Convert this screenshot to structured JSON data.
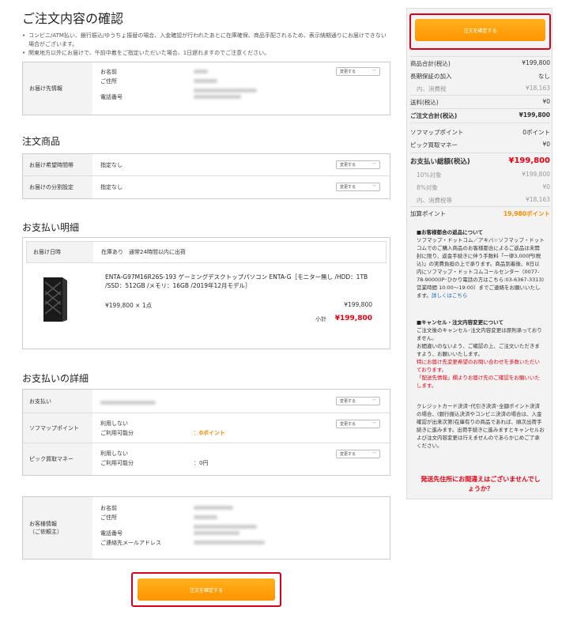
{
  "page": {
    "title": "ご注文内容の確認",
    "notes": [
      "コンビニ/ATM払い、銀行振込/ゆうちょ振替の場合、入金確認が行われたあとに在庫確保、商品手配されるため、表示納期通りにお届けできない場合がございます。",
      "関東地方以外にお届けで、午前中着をご指定いただいた場合、1日遅れますのでご注意ください。"
    ]
  },
  "delivery": {
    "label": "お届け先情報",
    "name_label": "お名前",
    "address_label": "ご住所",
    "phone_label": "電話番号",
    "change_label": "変更する"
  },
  "items_section": {
    "title": "注文商品",
    "rows": [
      {
        "label": "お届け希望時間帯",
        "value": "指定なし",
        "change": "変更する"
      },
      {
        "label": "お届けの分割設定",
        "value": "指定なし",
        "change": "変更する"
      }
    ]
  },
  "payment_detail": {
    "title": "お支払い明細",
    "date_label": "お届け日時",
    "date_value": "在庫あり　通常24時間以内に出荷",
    "product_name": "ENTA-G97M16R26S-193 ゲーミングデスクトップパソコン ENTA-G［モニター無し /HDD：1TB /SSD：512GB /メモリ：16GB /2019年12月モデル］",
    "unit_line": "¥199,800 × 1点",
    "line_total": "¥199,800",
    "subtotal_label": "小計",
    "subtotal_value": "¥199,800"
  },
  "payment_info": {
    "title": "お支払いの詳細",
    "method_label": "お支払い",
    "points_label": "ソフマップポイント",
    "points_use": "利用しない",
    "points_avail_label": "ご利用可能分",
    "points_avail_value": "0ポイント",
    "pick_label": "ピック買取マネー",
    "pick_use": "利用しない",
    "pick_avail_label": "ご利用可能分",
    "pick_avail_value": "0円",
    "change_label": "変更する"
  },
  "customer": {
    "label": "お客様情報\n（ご依頼主）",
    "name_label": "お名前",
    "address_label": "ご住所",
    "phone_label": "電話番号",
    "email_label": "ご連絡先メールアドレス"
  },
  "confirm_button": "注文を確定する",
  "summary": {
    "rows": [
      {
        "label": "商品合計(税込)",
        "value": "¥199,800"
      },
      {
        "label": "長期保証の加入",
        "value": "なし"
      },
      {
        "label": "内、消費税",
        "value": "¥18,163"
      },
      {
        "label": "送料(税込)",
        "value": "¥0"
      },
      {
        "label": "ご注文合計(税込)",
        "value": "¥199,800"
      },
      {
        "label": "ソフマップポイント",
        "value": "0ポイント"
      },
      {
        "label": "ピック買取マネー",
        "value": "¥0"
      },
      {
        "label": "お支払い総額(税込)",
        "value": "¥199,800"
      },
      {
        "label": "10%対象",
        "value": "¥199,800"
      },
      {
        "label": "8%対象",
        "value": "¥0"
      },
      {
        "label": "内、消費税等",
        "value": "¥18,163"
      },
      {
        "label": "加算ポイント",
        "value": "19,980ポイント"
      }
    ],
    "return_title": "■お客様都合の返品について",
    "return_body": "ソフマップ・ドットコム／アキバ☆ソフマップ・ドットコムでのご購入商品のお客様都合によるご返品は未開封に限り、返金手続きに伴う手数料「一律3,000円(税込)」の実費負担の上で承ります。商品到着後、8日以内にソフマップ・ドットコムコールセンター（0077-78-9000(IP･ひかり電話の方はこちら:03-6367-3313) 営業時間 10:00～19:00）までご連絡をお願いいたします。",
    "return_link": "詳しくはこちら",
    "cancel_title": "■キャンセル・注文内容変更について",
    "cancel_body": "ご注文後のキャンセル･注文内容変更は原則承っておりません。\nお間違いのないよう、ご確認の上、ご注文いただきますよう、お願いいたします。",
    "cancel_red1": "特にお届け先変更希望のお問い合わせを多数いただいております。",
    "cancel_red2": "「配送先情報」欄よりお届け先のご確認をお願いいたします。",
    "credit_body": "クレジットカード決済･代引き決済･全額ポイント決済の場合、(銀行振込決済やコンビニ決済の場合は、入金確認が出来次第)在庫有りの商品であれば、順次出荷手続きに進みます。出荷手続きに進みますとキャンセルおよび注文内容変更は行えませんのであらかじめご了承ください。",
    "warning": "発送先住所にお間違えはございませんでしょうか？"
  },
  "colors": {
    "accent": "#ff9c00",
    "price_red": "#e60012",
    "frame_red": "#d8001a"
  }
}
